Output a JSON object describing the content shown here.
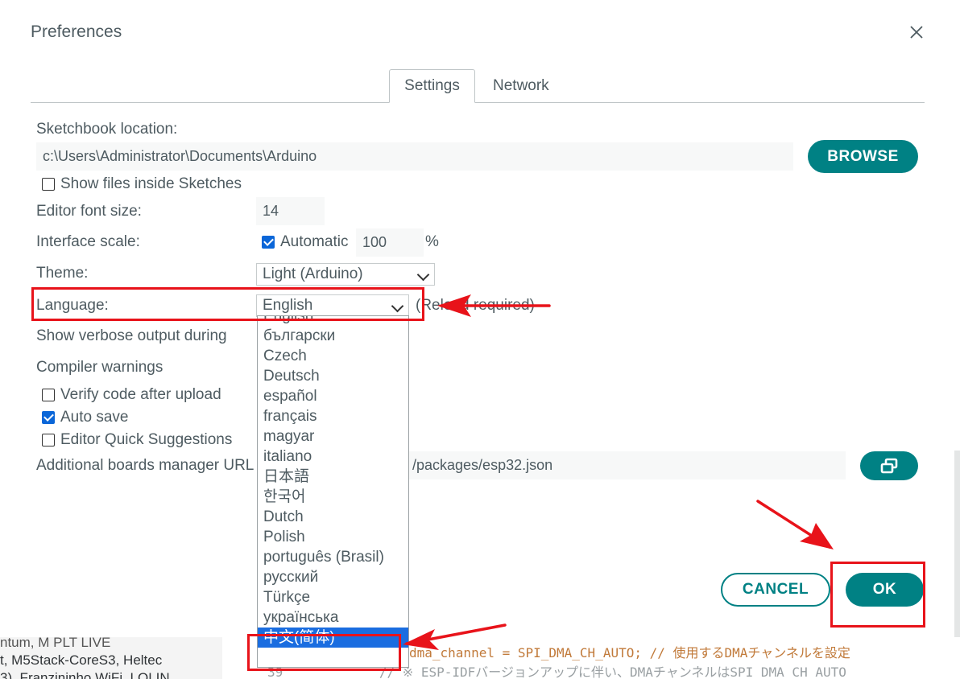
{
  "background": {
    "left_lines": [
      "ntum, M PLT LIVE",
      "t, M5Stack-CoreS3, Heltec",
      "3), Franzininho WiFi, LOLIN"
    ],
    "code_line1": "dma_channel = SPI_DMA_CH_AUTO; // 使用するDMAチャンネルを設定",
    "code_line2_num": "39",
    "code_line2": "// ※ ESP-IDFバージョンアップに伴い、DMAチャンネルはSPI_DMA_CH_AUTO"
  },
  "dialog": {
    "title": "Preferences",
    "tabs": [
      "Settings",
      "Network"
    ],
    "sketchbook_label": "Sketchbook location:",
    "sketchbook_value": "c:\\Users\\Administrator\\Documents\\Arduino",
    "browse_label": "BROWSE",
    "show_files_label": "Show files inside Sketches",
    "font_size_label": "Editor font size:",
    "font_size_value": "14",
    "interface_scale_label": "Interface scale:",
    "automatic_label": "Automatic",
    "scale_value": "100",
    "percent": "%",
    "theme_label": "Theme:",
    "theme_value": "Light (Arduino)",
    "language_label": "Language:",
    "language_value": "English",
    "reload_note": "(Reload required)",
    "verbose_label": "Show verbose output during",
    "compiler_warnings_label": "Compiler warnings",
    "verify_label": "Verify code after upload",
    "autosave_label": "Auto save",
    "quick_suggestions_label": "Editor Quick Suggestions",
    "boards_url_label": "Additional boards manager URL",
    "boards_url_value": "/packages/esp32.json",
    "cancel_label": "CANCEL",
    "ok_label": "OK"
  },
  "language_options": [
    "English",
    "български",
    "Czech",
    "Deutsch",
    "español",
    "français",
    "magyar",
    "italiano",
    "日本語",
    "한국어",
    "Dutch",
    "Polish",
    "português (Brasil)",
    "русский",
    "Türkçe",
    "українська",
    "中文(简体)"
  ],
  "selected_language": "中文(简体)",
  "colors": {
    "accent": "#008184",
    "annotation_red": "#e8131a",
    "highlight": "#1a6de0"
  }
}
